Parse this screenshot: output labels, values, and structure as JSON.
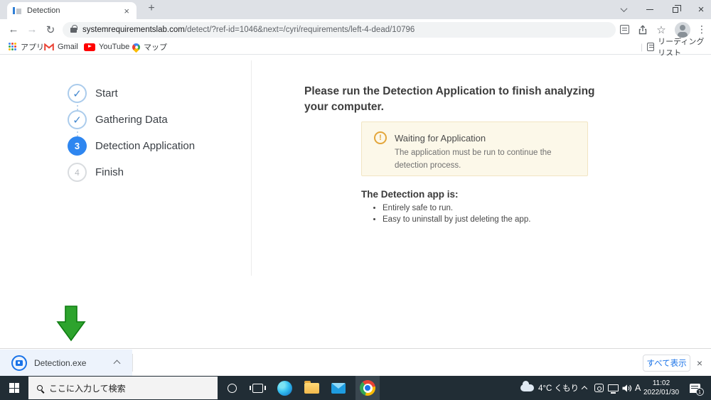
{
  "window": {
    "tab_title": "Detection"
  },
  "toolbar": {
    "url_domain": "systemrequirementslab.com",
    "url_path": "/detect/?ref-id=1046&next=/cyri/requirements/left-4-dead/10796"
  },
  "bookmarks": {
    "apps": "アプリ",
    "gmail": "Gmail",
    "youtube": "YouTube",
    "maps": "マップ",
    "reading_list": "リーディング リスト"
  },
  "wizard": {
    "steps": [
      {
        "label": "Start",
        "glyph": "✓",
        "state": "done"
      },
      {
        "label": "Gathering Data",
        "glyph": "✓",
        "state": "done"
      },
      {
        "label": "Detection Application",
        "glyph": "3",
        "state": "active"
      },
      {
        "label": "Finish",
        "glyph": "4",
        "state": "pending"
      }
    ]
  },
  "content": {
    "title": "Please run the Detection Application to finish analyzing your computer.",
    "alert": {
      "icon": "!",
      "title": "Waiting for Application",
      "body": "The application must be run to continue the detection process."
    },
    "app_heading": "The Detection app is:",
    "app_bullets": [
      "Entirely safe to run.",
      "Easy to uninstall by just deleting the app."
    ]
  },
  "download_bar": {
    "file_name": "Detection.exe",
    "show_all": "すべて表示"
  },
  "taskbar": {
    "search_placeholder": "ここに入力して検索",
    "weather": "4°C くもり",
    "ime": "A",
    "time": "11:02",
    "date": "2022/01/30",
    "notification_count": "1"
  },
  "glyphs": {
    "close": "×",
    "new_tab": "+",
    "back": "←",
    "forward": "→",
    "reload": "↻",
    "star": "☆",
    "overflow": "⋮",
    "separator": "|"
  },
  "colors": {
    "accent_blue": "#1a73e8",
    "step_active": "#2e86f0",
    "alert_bg": "#fcf8e9",
    "alert_border": "#f1e5c3",
    "alert_icon": "#e3a63b",
    "arrow_green": "#2da32d",
    "taskbar_bg": "#212d35"
  }
}
